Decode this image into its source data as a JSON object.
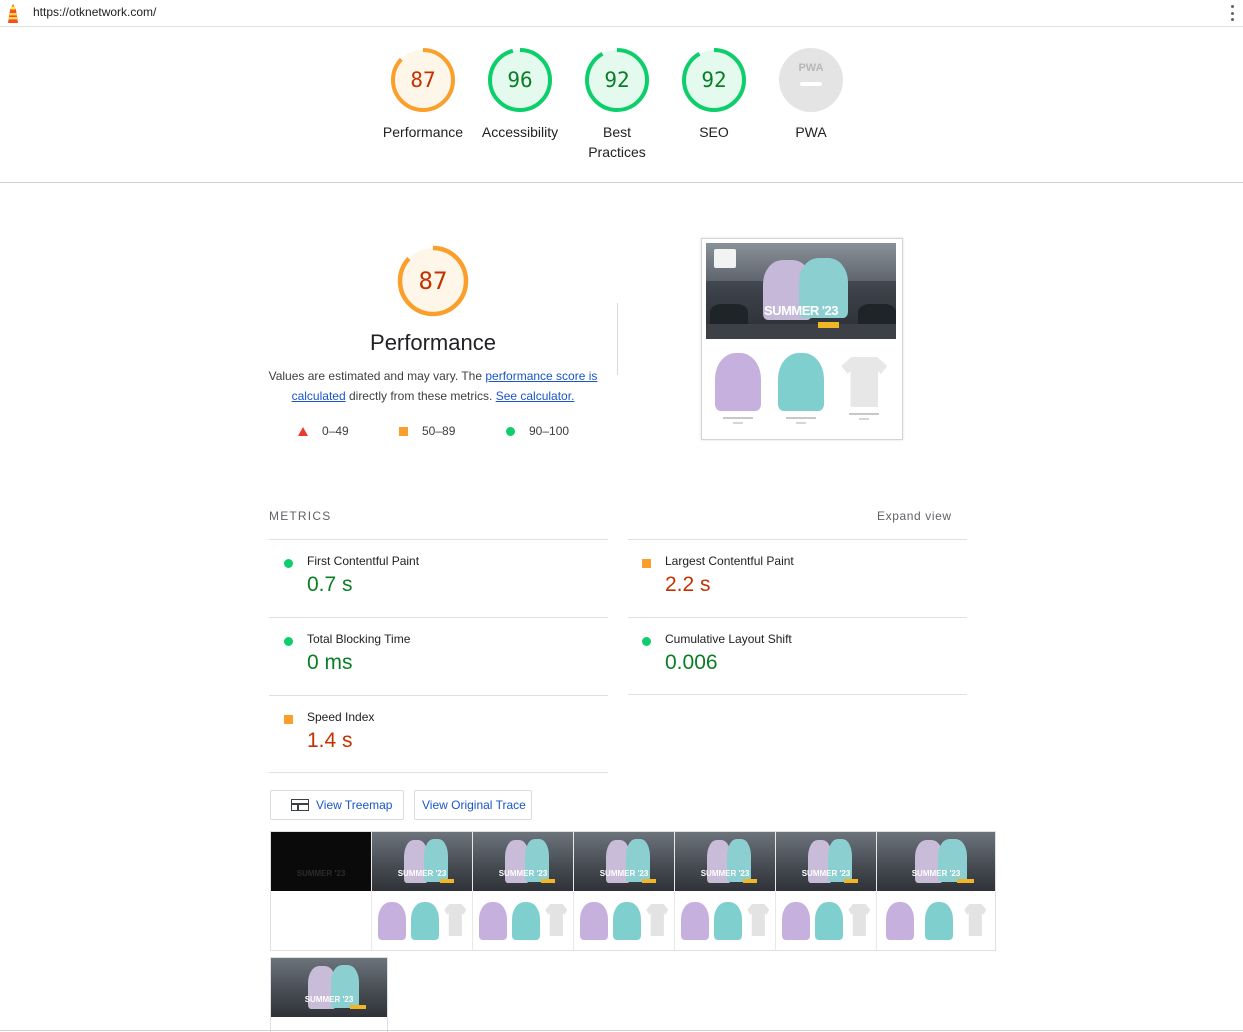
{
  "topbar": {
    "url": "https://otknetwork.com/"
  },
  "categories": [
    {
      "label": "Performance",
      "score": "87",
      "status": "average"
    },
    {
      "label": "Accessibility",
      "score": "96",
      "status": "pass"
    },
    {
      "label": "Best Practices",
      "score": "92",
      "status": "pass"
    },
    {
      "label": "SEO",
      "score": "92",
      "status": "pass"
    },
    {
      "label": "PWA",
      "score": "",
      "status": "na"
    }
  ],
  "colors": {
    "average": "#fa9f2c",
    "average_text": "#c33300",
    "average_fill": "#fff6ea",
    "pass": "#0cce6b",
    "pass_text": "#0a7e26",
    "pass_fill": "#e5faef",
    "fail": "#eb3b2f",
    "link": "#1a56c8"
  },
  "performance": {
    "score": "87",
    "title": "Performance",
    "desc_prefix": "Values are estimated and may vary. The ",
    "link1": "performance score is calculated",
    "desc_middle": " directly from these metrics. ",
    "link2": "See calculator.",
    "legend": [
      {
        "shape": "triangle",
        "range": "0–49"
      },
      {
        "shape": "square",
        "range": "50–89"
      },
      {
        "shape": "circle",
        "range": "90–100"
      }
    ]
  },
  "final_screenshot": {
    "hero_text": "SUMMER '23",
    "products": [
      "Bolt Hoodie Purple",
      "Bolt Hoodie Mint",
      "Bolt Tee Lite Grey"
    ]
  },
  "metrics": {
    "heading": "METRICS",
    "expand_label": "Expand view",
    "items": [
      {
        "name": "First Contentful Paint",
        "value": "0.7 s",
        "status": "pass"
      },
      {
        "name": "Largest Contentful Paint",
        "value": "2.2 s",
        "status": "average"
      },
      {
        "name": "Total Blocking Time",
        "value": "0 ms",
        "status": "pass"
      },
      {
        "name": "Cumulative Layout Shift",
        "value": "0.006",
        "status": "pass"
      },
      {
        "name": "Speed Index",
        "value": "1.4 s",
        "status": "average"
      }
    ]
  },
  "buttons": {
    "treemap": "View Treemap",
    "trace": "View Original Trace"
  },
  "filmstrip": {
    "hero_text": "SUMMER '23",
    "frame_count": 8
  }
}
